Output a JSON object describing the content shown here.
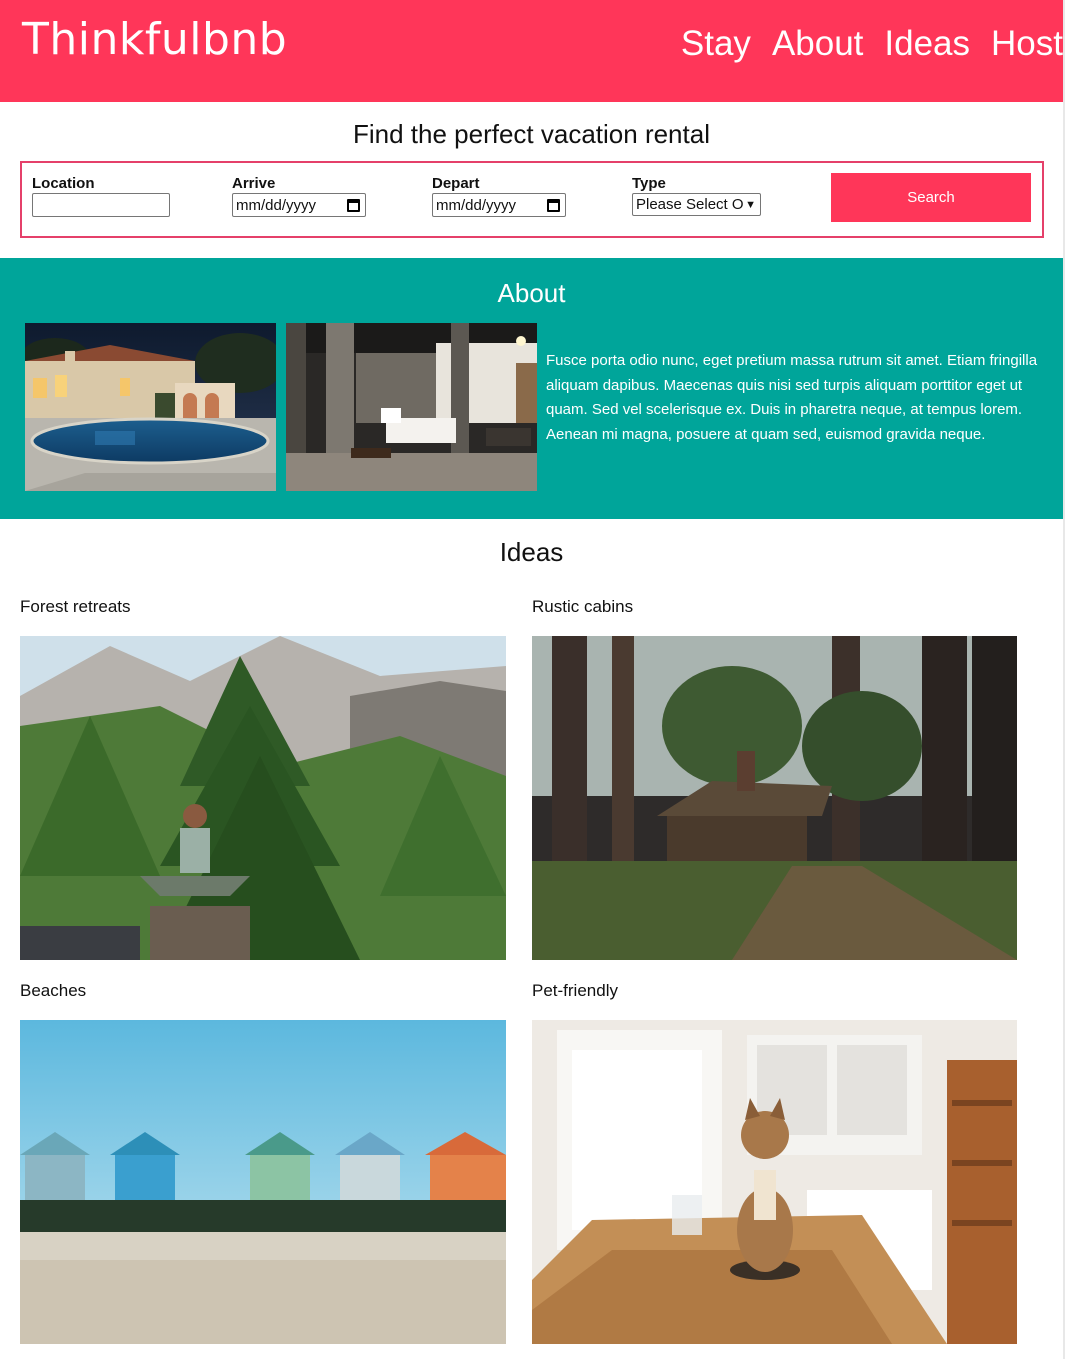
{
  "header": {
    "logo": "Thinkfulbnb",
    "nav": [
      "Stay",
      "About",
      "Ideas",
      "Host"
    ],
    "brand_color": "#ff3659"
  },
  "search": {
    "title": "Find the perfect vacation rental",
    "location_label": "Location",
    "location_value": "",
    "arrive_label": "Arrive",
    "arrive_value": "mm/dd/yyyy",
    "depart_label": "Depart",
    "depart_value": "mm/dd/yyyy",
    "type_label": "Type",
    "type_selected": "Please Select O",
    "button_label": "Search",
    "border_color": "#e5406a"
  },
  "about": {
    "title": "About",
    "background_color": "#00a59a",
    "text": "Fusce porta odio nunc, eget pretium massa rutrum sit amet. Etiam fringilla aliquam dapibus. Maecenas quis nisi sed turpis aliquam porttitor eget ut quam. Sed vel scelerisque ex. Duis in pharetra neque, at tempus lorem. Aenean mi magna, posuere at quam sed, euismod gravida neque."
  },
  "ideas": {
    "title": "Ideas",
    "items": [
      {
        "label": "Forest retreats"
      },
      {
        "label": "Rustic cabins"
      },
      {
        "label": "Beaches"
      },
      {
        "label": "Pet-friendly"
      }
    ]
  }
}
